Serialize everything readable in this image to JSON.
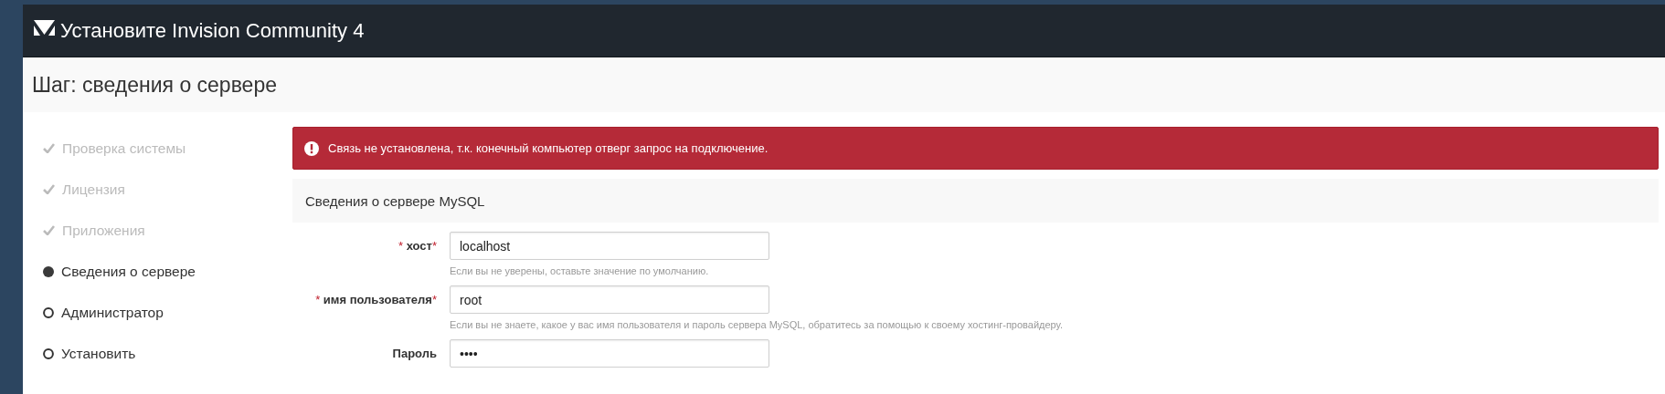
{
  "header": {
    "title": "Установите Invision Community 4"
  },
  "step_title": "Шаг: сведения о сервере",
  "steps": [
    {
      "label": "Проверка системы",
      "completed": true,
      "selected": false
    },
    {
      "label": "Лицензия",
      "completed": true,
      "selected": false
    },
    {
      "label": "Приложения",
      "completed": true,
      "selected": false
    },
    {
      "label": "Сведения о сервере",
      "completed": false,
      "selected": true
    },
    {
      "label": "Администратор",
      "completed": false,
      "selected": false
    },
    {
      "label": "Установить",
      "completed": false,
      "selected": false
    }
  ],
  "error": {
    "message": "Связь не установлена, т.к. конечный компьютер отверг запрос на подключение."
  },
  "section": {
    "title": "Сведения о сервере MySQL"
  },
  "fields": [
    {
      "label": "хост",
      "mark_before": "*",
      "mark_after": "*",
      "value": "localhost",
      "hint": "Если вы не уверены, оставьте значение по умолчанию."
    },
    {
      "label": "имя пользователя",
      "mark_before": "*",
      "mark_after": "*",
      "value": "root",
      "hint": "Если вы не знаете, какое у вас имя пользователя и пароль сервера MySQL, обратитесь за помощью к своему хостинг-провайдеру."
    },
    {
      "label": "Пароль",
      "value": "••••"
    }
  ]
}
